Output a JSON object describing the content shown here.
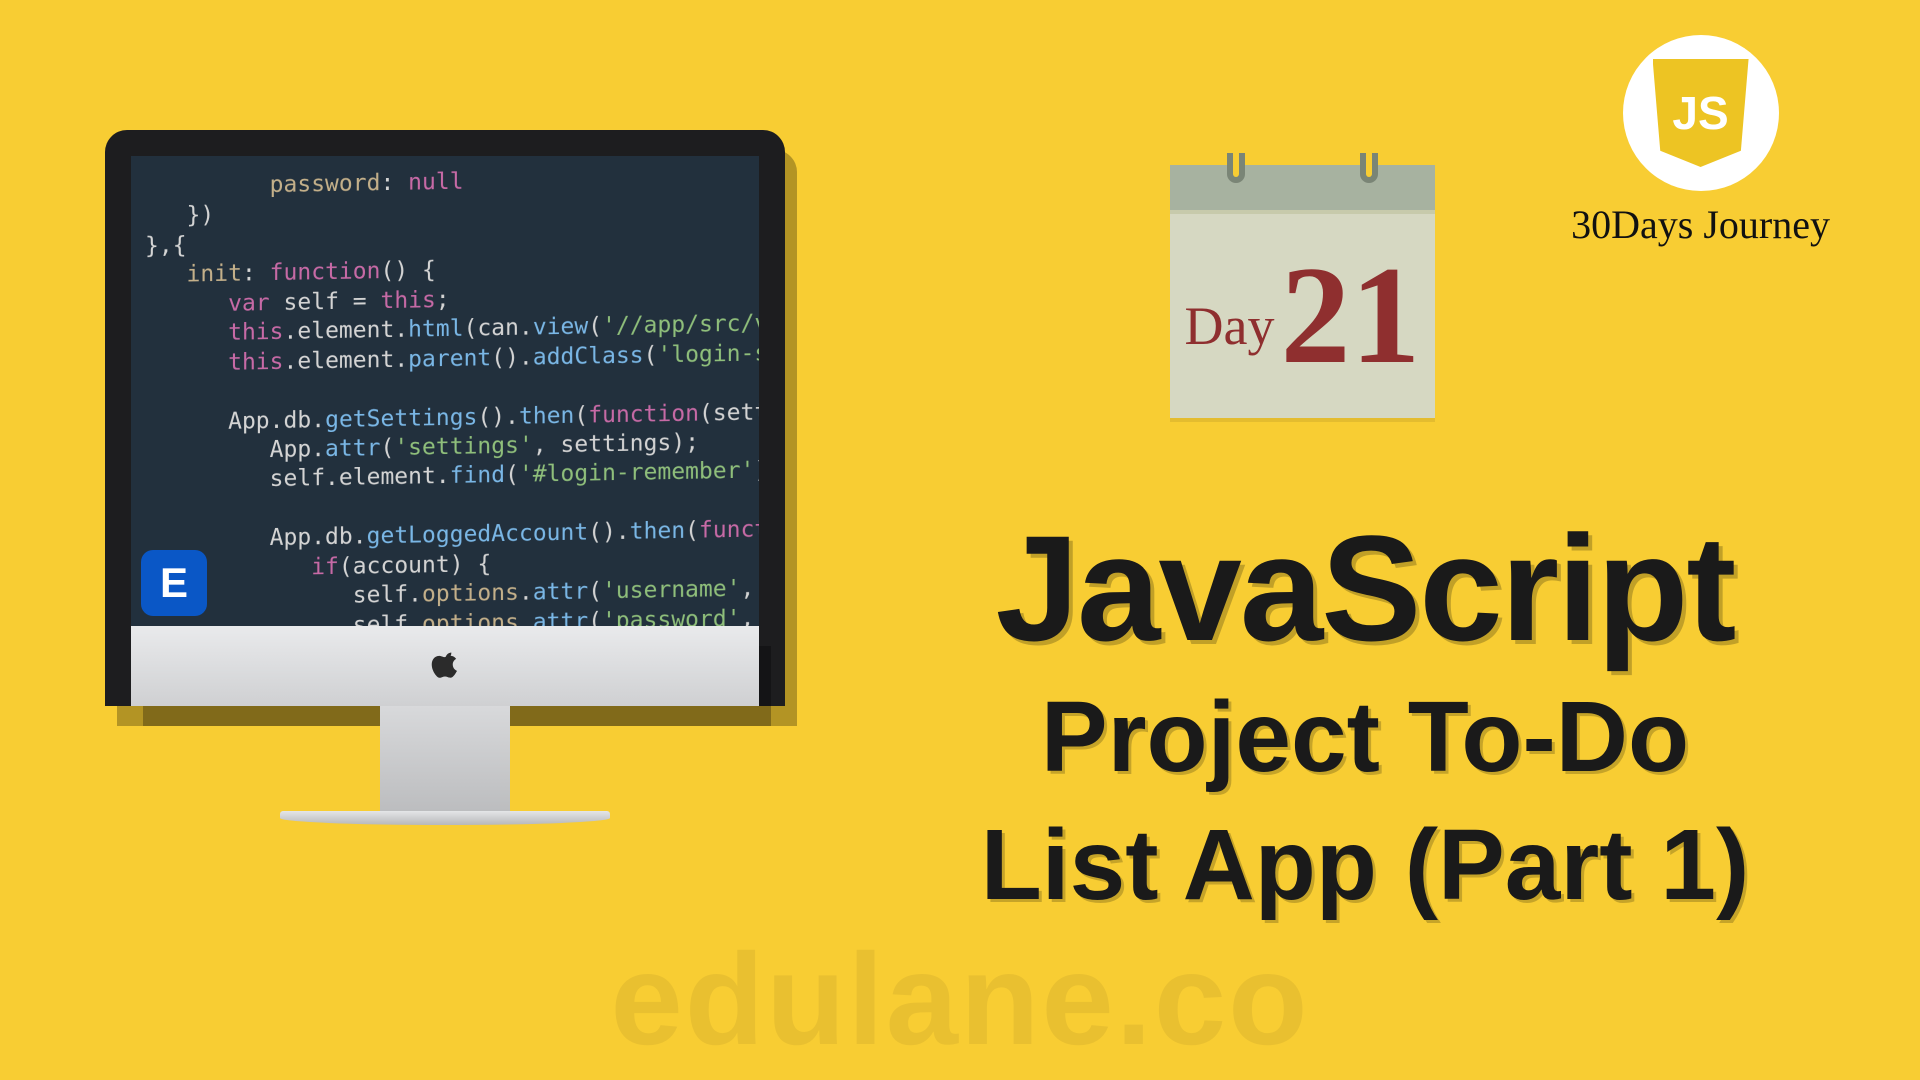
{
  "colors": {
    "background": "#f8cd33",
    "headline": "#1a1a1a",
    "calendar_body": "#d6d8c2",
    "calendar_header": "#a7b2a0",
    "calendar_ink": "#8f2f2f",
    "corner_badge_bg": "#0a57c6",
    "js_shield": "#edc423"
  },
  "journey": {
    "shield_text": "JS",
    "caption": "30Days Journey"
  },
  "calendar": {
    "day_label": "Day",
    "day_number": "21"
  },
  "headline": {
    "title": "JavaScript",
    "subtitle_line1": "Project To-Do",
    "subtitle_line2": "List App (Part 1)"
  },
  "corner_badge": {
    "letter": "E"
  },
  "watermark": "edulane.co",
  "code_lines": [
    {
      "indent": 3,
      "html": "<span class='p'>password</span><span class='o'>:</span> <span class='sp'>null</span>"
    },
    {
      "indent": 1,
      "html": "<span class='br'>})</span>"
    },
    {
      "indent": 0,
      "html": "<span class='br'>},{</span>"
    },
    {
      "indent": 1,
      "html": "<span class='p'>init</span><span class='o'>:</span> <span class='kw'>function</span><span class='br'>()</span> <span class='br'>{</span>"
    },
    {
      "indent": 2,
      "html": "<span class='kw'>var</span> <span class='v'>self</span> <span class='o'>=</span> <span class='kw'>this</span><span class='o'>;</span>"
    },
    {
      "indent": 2,
      "html": "<span class='kw'>this</span><span class='o'>.</span><span class='v'>element</span><span class='o'>.</span><span class='fn'>html</span><span class='br'>(</span><span class='v'>can</span><span class='o'>.</span><span class='fn'>view</span><span class='br'>(</span><span class='s'>'//app/src/views/sig</span>"
    },
    {
      "indent": 2,
      "html": "<span class='kw'>this</span><span class='o'>.</span><span class='v'>element</span><span class='o'>.</span><span class='fn'>parent</span><span class='br'>().</span><span class='fn'>addClass</span><span class='br'>(</span><span class='s'>'login-screen'</span><span class='br'>);</span>"
    },
    {
      "indent": 0,
      "html": " "
    },
    {
      "indent": 2,
      "html": "<span class='v'>App</span><span class='o'>.</span><span class='v'>db</span><span class='o'>.</span><span class='fn'>getSettings</span><span class='br'>().</span><span class='fn'>then</span><span class='br'>(</span><span class='kw'>function</span><span class='br'>(</span><span class='v'>settings</span><span class='br'>)</span> <span class='br'>{</span>"
    },
    {
      "indent": 3,
      "html": "<span class='v'>App</span><span class='o'>.</span><span class='fn'>attr</span><span class='br'>(</span><span class='s'>'settings'</span><span class='o'>,</span> <span class='v'>settings</span><span class='br'>);</span>"
    },
    {
      "indent": 3,
      "html": "<span class='v'>self</span><span class='o'>.</span><span class='v'>element</span><span class='o'>.</span><span class='fn'>find</span><span class='br'>(</span><span class='s'>'#login-remember'</span><span class='br'>).</span><span class='fn'>prop</span><span class='br'>(</span><span class='s'>'</span>"
    },
    {
      "indent": 0,
      "html": " "
    },
    {
      "indent": 3,
      "html": "<span class='v'>App</span><span class='o'>.</span><span class='v'>db</span><span class='o'>.</span><span class='fn'>getLoggedAccount</span><span class='br'>().</span><span class='fn'>then</span><span class='br'>(</span><span class='kw'>function</span><span class='br'>(</span><span class='v'>acc</span>"
    },
    {
      "indent": 4,
      "html": "<span class='kw'>if</span><span class='br'>(</span><span class='v'>account</span><span class='br'>)</span> <span class='br'>{</span>"
    },
    {
      "indent": 5,
      "html": "<span class='v'>self</span><span class='o'>.</span><span class='p'>options</span><span class='o'>.</span><span class='fn'>attr</span><span class='br'>(</span><span class='s'>'username'</span><span class='o'>,</span> <span class='v'>acco</span>"
    },
    {
      "indent": 5,
      "html": "<span class='v'>self</span><span class='o'>.</span><span class='p'>options</span><span class='o'>.</span><span class='fn'>attr</span><span class='br'>(</span><span class='s'>'password'</span><span class='o'>,</span> <span class='v'>acco</span>"
    }
  ]
}
